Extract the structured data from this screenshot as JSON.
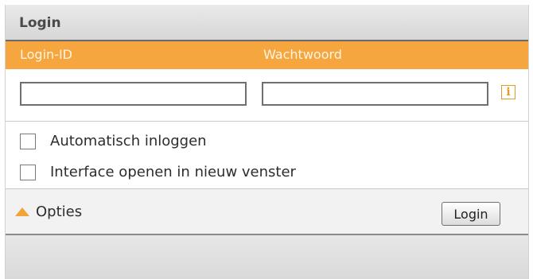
{
  "header": {
    "title": "Login"
  },
  "columns": {
    "login_id": "Login-ID",
    "password": "Wachtwoord"
  },
  "fields": {
    "login_value": "",
    "password_value": ""
  },
  "info": {
    "glyph": "i",
    "icon": "info-icon"
  },
  "options": [
    {
      "label": "Automatisch inloggen",
      "checked": false
    },
    {
      "label": "Interface openen in nieuw venster",
      "checked": false
    }
  ],
  "footer": {
    "options_label": "Opties",
    "login_button": "Login"
  },
  "colors": {
    "accent": "#f6a63f",
    "header_bg": "#dedede"
  }
}
